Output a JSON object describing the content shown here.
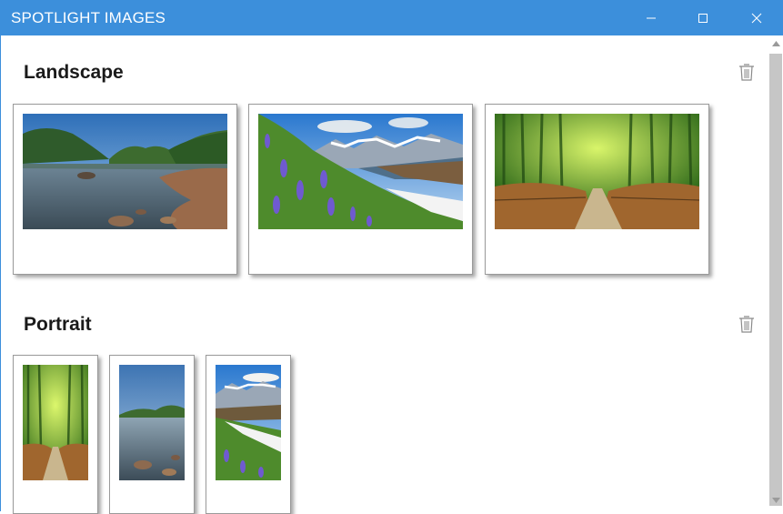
{
  "window": {
    "title": "SPOTLIGHT IMAGES",
    "controls": {
      "minimize_icon": "minimize-icon",
      "maximize_icon": "maximize-icon",
      "close_icon": "close-icon"
    },
    "accent_color": "#3c8fdb"
  },
  "sections": [
    {
      "title": "Landscape",
      "delete_icon": "trash-icon",
      "images": [
        {
          "subject": "lake-with-rocks-and-hills",
          "icon": "photo"
        },
        {
          "subject": "mountain-meadow-with-lupine-flowers",
          "icon": "photo"
        },
        {
          "subject": "bamboo-forest-path",
          "icon": "photo"
        }
      ]
    },
    {
      "title": "Portrait",
      "delete_icon": "trash-icon",
      "images": [
        {
          "subject": "bamboo-forest-path",
          "icon": "photo"
        },
        {
          "subject": "lake-with-rocks-and-hills",
          "icon": "photo"
        },
        {
          "subject": "mountain-meadow-with-lupine-flowers",
          "icon": "photo"
        }
      ]
    }
  ],
  "scrollbar": {
    "up_icon": "scroll-up-arrow-icon",
    "down_icon": "scroll-down-arrow-icon"
  }
}
